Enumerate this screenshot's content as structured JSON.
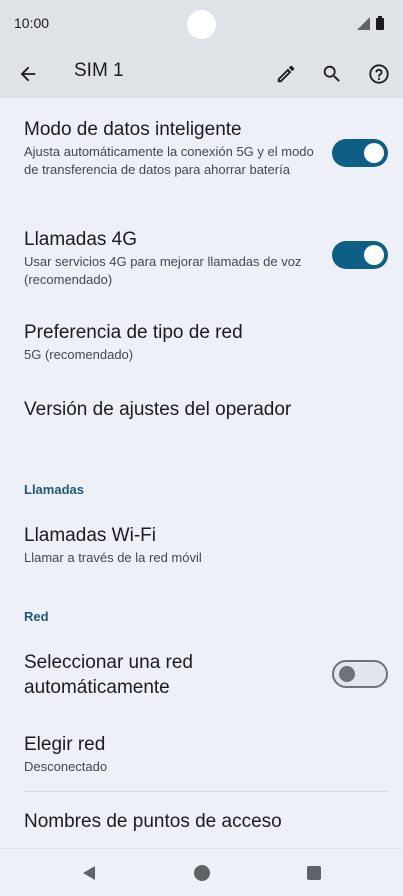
{
  "status": {
    "time": "10:00"
  },
  "app_bar": {
    "title": "SIM 1"
  },
  "settings": {
    "smart_data": {
      "title": "Modo de datos inteligente",
      "subtitle": "Ajusta automáticamente la conexión 5G y el modo de transferencia de datos para ahorrar batería",
      "enabled": true
    },
    "calls_4g": {
      "title": "Llamadas 4G",
      "subtitle": "Usar servicios 4G para mejorar llamadas de voz (recomendado)",
      "enabled": true
    },
    "network_type": {
      "title": "Preferencia de tipo de red",
      "subtitle": "5G (recomendado)"
    },
    "carrier_version": {
      "title": "Versión de ajustes del operador"
    }
  },
  "sections": {
    "calls": "Llamadas",
    "network": "Red"
  },
  "calls": {
    "wifi_calling": {
      "title": "Llamadas Wi-Fi",
      "subtitle": "Llamar a través de la red móvil"
    }
  },
  "network": {
    "auto_select": {
      "title_line1": "Seleccionar una red",
      "title_line2": "automáticamente",
      "enabled": false
    },
    "choose_network": {
      "title": "Elegir red",
      "subtitle": "Desconectado"
    },
    "apn": {
      "title": "Nombres de puntos de acceso"
    }
  },
  "colors": {
    "accent": "#0d5f86",
    "section_header": "#1d5a78",
    "background": "#eef0f7",
    "app_bar": "#dfe3e8"
  }
}
